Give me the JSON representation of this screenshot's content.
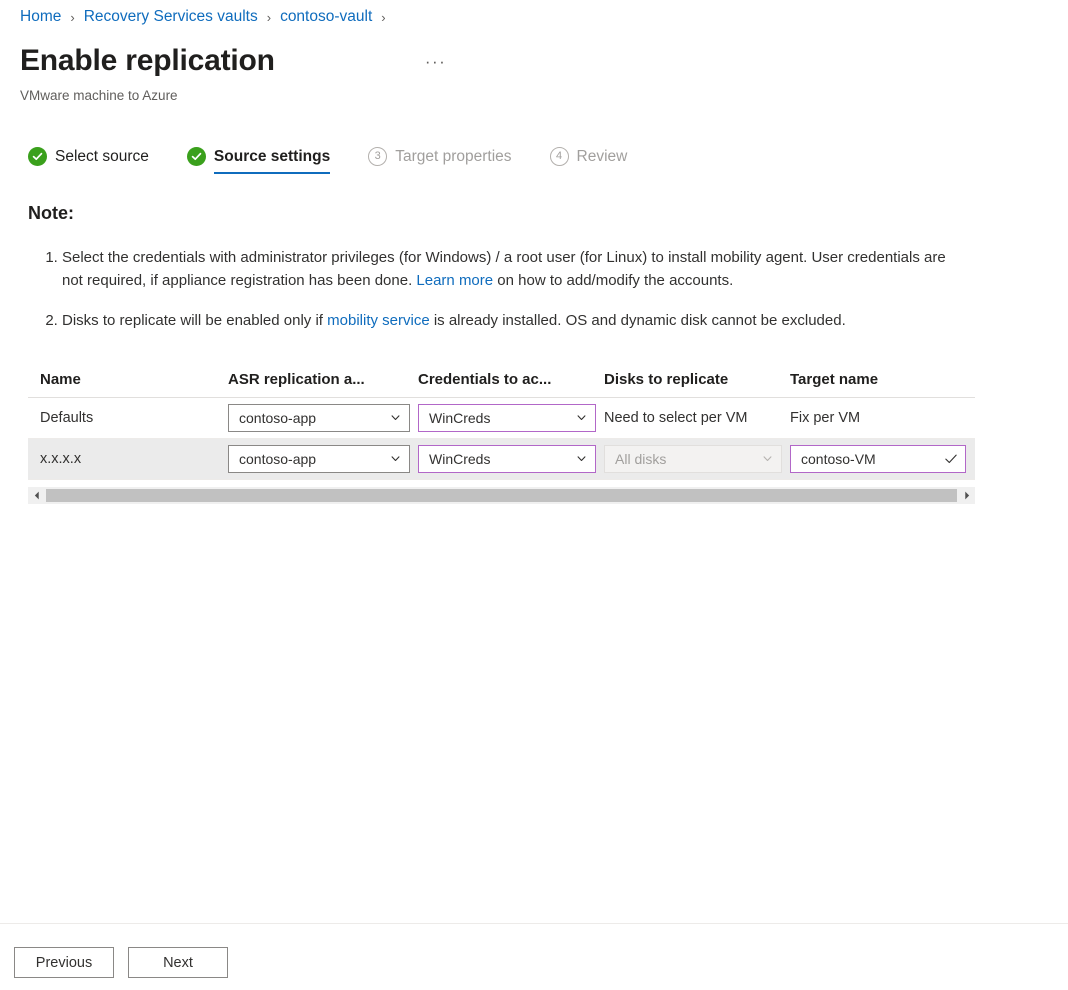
{
  "breadcrumb": {
    "items": [
      {
        "label": "Home"
      },
      {
        "label": "Recovery Services vaults"
      },
      {
        "label": "contoso-vault"
      }
    ],
    "separator": "›"
  },
  "header": {
    "title": "Enable replication",
    "subtitle": "VMware machine to Azure",
    "overflow_label": "···"
  },
  "steps": [
    {
      "label": "Select source",
      "state": "done",
      "number": "1"
    },
    {
      "label": "Source settings",
      "state": "current",
      "number": "2"
    },
    {
      "label": "Target properties",
      "state": "todo",
      "number": "3"
    },
    {
      "label": "Review",
      "state": "todo",
      "number": "4"
    }
  ],
  "note": {
    "heading": "Note:",
    "items": [
      {
        "part1": "Select the credentials with administrator privileges (for Windows) / a root user (for Linux) to install mobility agent. User credentials are not required, if appliance registration has been done. ",
        "link": "Learn more",
        "part2": " on how to add/modify the accounts."
      },
      {
        "part1": "Disks to replicate will be enabled only if ",
        "link": "mobility service",
        "part2": " is already installed. OS and dynamic disk cannot be excluded."
      }
    ]
  },
  "table": {
    "columns": [
      "Name",
      "ASR replication a...",
      "Credentials to ac...",
      "Disks to replicate",
      "Target name"
    ],
    "rows": [
      {
        "name": "Defaults",
        "asr_policy": "contoso-app",
        "credentials": "WinCreds",
        "disks": "Need to select per VM",
        "target_name": "Fix per VM"
      },
      {
        "name": "x.x.x.x",
        "asr_policy": "contoso-app",
        "credentials": "WinCreds",
        "disks": "All disks",
        "target_name": "contoso-VM"
      }
    ]
  },
  "footer": {
    "previous_label": "Previous",
    "next_label": "Next"
  },
  "colors": {
    "link": "#0f6cbd",
    "accent_field_border": "#b267c8",
    "step_done": "#3aa01c",
    "selected_row": "#ebebeb"
  }
}
